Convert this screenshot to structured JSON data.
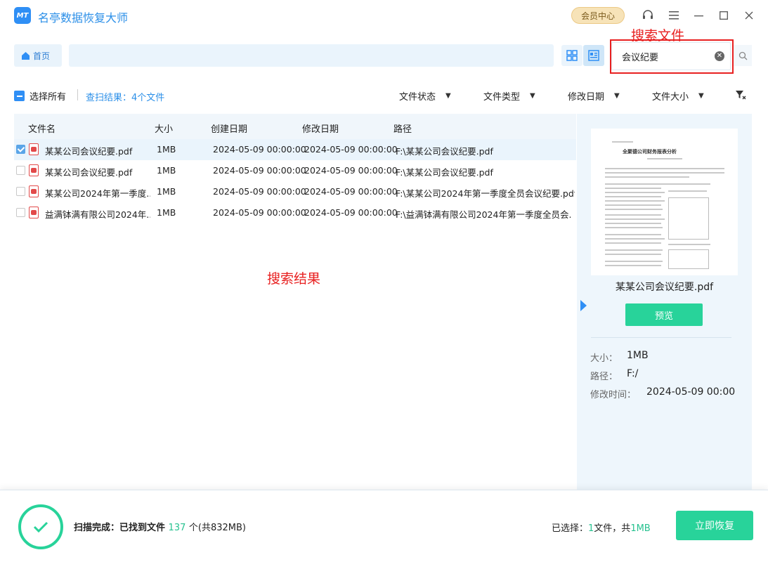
{
  "app": {
    "logo_text": "MT",
    "title": "名亭数据恢复大师",
    "vip_label": "会员中心"
  },
  "annotations": {
    "search_file": "搜索文件",
    "search_results": "搜索结果"
  },
  "nav": {
    "home_label": "首页",
    "path_value": ""
  },
  "search": {
    "value": "会议纪要"
  },
  "toolbar": {
    "select_all": "选择所有",
    "scan_result": "查扫结果：4个文件",
    "filters": [
      "文件状态",
      "文件类型",
      "修改日期",
      "文件大小"
    ]
  },
  "table": {
    "columns": [
      "文件名",
      "大小",
      "创建日期",
      "修改日期",
      "路径"
    ],
    "rows": [
      {
        "checked": true,
        "name": "某某公司会议纪要.pdf",
        "size": "1MB",
        "created": "2024-05-09 00:00:00",
        "modified": "2024-05-09 00:00:00",
        "path": "F:\\某某公司会议纪要.pdf"
      },
      {
        "checked": false,
        "name": "某某公司会议纪要.pdf",
        "size": "1MB",
        "created": "2024-05-09 00:00:00",
        "modified": "2024-05-09 00:00:00",
        "path": "F:\\某某公司会议纪要.pdf"
      },
      {
        "checked": false,
        "name": "某某公司2024年第一季度...",
        "size": "1MB",
        "created": "2024-05-09 00:00:00",
        "modified": "2024-05-09 00:00:00",
        "path": "F:\\某某公司2024年第一季度全员会议纪要.pdf"
      },
      {
        "checked": false,
        "name": "益满钵满有限公司2024年...",
        "size": "1MB",
        "created": "2024-05-09 00:00:00",
        "modified": "2024-05-09 00:00:00",
        "path": "F:\\益满钵满有限公司2024年第一季度全员会..."
      }
    ]
  },
  "preview": {
    "doc_heading": "全聚德公司财务报表分析",
    "file_name": "某某公司会议纪要.pdf",
    "button_label": "预览",
    "size_label": "大小：",
    "size_value": "1MB",
    "path_label": "路径：",
    "path_value": "F:/",
    "modified_label": "修改时间：",
    "modified_value": "2024-05-09 00:00"
  },
  "footer": {
    "scan_done_label": "扫描完成：已找到文件",
    "found_count": "137",
    "found_rest": "个(共832MB)",
    "selected_prefix": "已选择：",
    "selected_count": "1",
    "selected_mid": "文件，共",
    "selected_size": "1MB",
    "recover_label": "立即恢复"
  },
  "colors": {
    "accent": "#2f8ff5",
    "green": "#28d39a",
    "annotation": "#e82020"
  }
}
